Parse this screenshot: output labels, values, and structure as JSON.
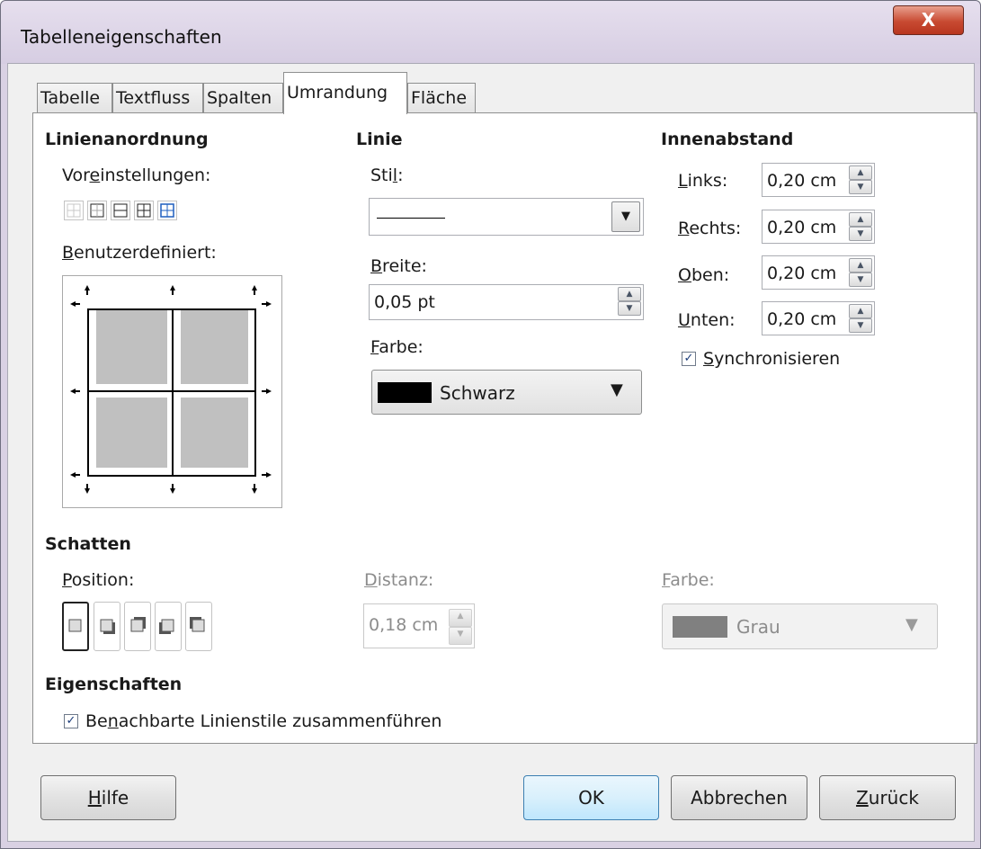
{
  "window": {
    "title": "Tabelleneigenschaften",
    "close_label": "X"
  },
  "tabs": [
    {
      "label": "Tabelle"
    },
    {
      "label": "Textfluss"
    },
    {
      "label": "Spalten"
    },
    {
      "label": "Umrandung",
      "active": true
    },
    {
      "label": "Fläche"
    }
  ],
  "line_arrangement": {
    "heading": "Linienanordnung",
    "presets_label_pre": "Vor",
    "presets_label_u": "e",
    "presets_label_post": "instellungen:",
    "custom_label_u": "B",
    "custom_label_post": "enutzerdefiniert:"
  },
  "line": {
    "heading": "Linie",
    "style_label_pre": "Sti",
    "style_label_u": "l",
    "style_label_post": ":",
    "width_label_u": "B",
    "width_label_post": "reite:",
    "width_value": "0,05 pt",
    "color_label_u": "F",
    "color_label_post": "arbe:",
    "color_value": "Schwarz",
    "color_swatch": "#000000"
  },
  "padding": {
    "heading": "Innenabstand",
    "left_label_u": "L",
    "left_label_post": "inks:",
    "left_value": "0,20 cm",
    "right_label_u": "R",
    "right_label_post": "echts:",
    "right_value": "0,20 cm",
    "top_label_u": "O",
    "top_label_post": "ben:",
    "top_value": "0,20 cm",
    "bottom_label_u": "U",
    "bottom_label_post": "nten:",
    "bottom_value": "0,20 cm",
    "sync_label_u": "S",
    "sync_label_post": "ynchronisieren",
    "sync_checked": true
  },
  "shadow": {
    "heading": "Schatten",
    "position_label_u": "P",
    "position_label_post": "osition:",
    "distance_label_u": "D",
    "distance_label_post": "istanz:",
    "distance_value": "0,18 cm",
    "color_label_u": "F",
    "color_label_post": "arbe:",
    "color_value": "Grau",
    "color_swatch": "#808080"
  },
  "properties": {
    "heading": "Eigenschaften",
    "merge_label_pre": "Be",
    "merge_label_u": "n",
    "merge_label_post": "achbarte Linienstile zusammenführen",
    "merge_checked": true
  },
  "buttons": {
    "help_u": "H",
    "help_post": "ilfe",
    "ok": "OK",
    "cancel": "Abbrechen",
    "reset_u": "Z",
    "reset_post": "urück"
  },
  "colors": {
    "accent_blue": "#3c7fb1",
    "close_red": "#c84a32"
  }
}
